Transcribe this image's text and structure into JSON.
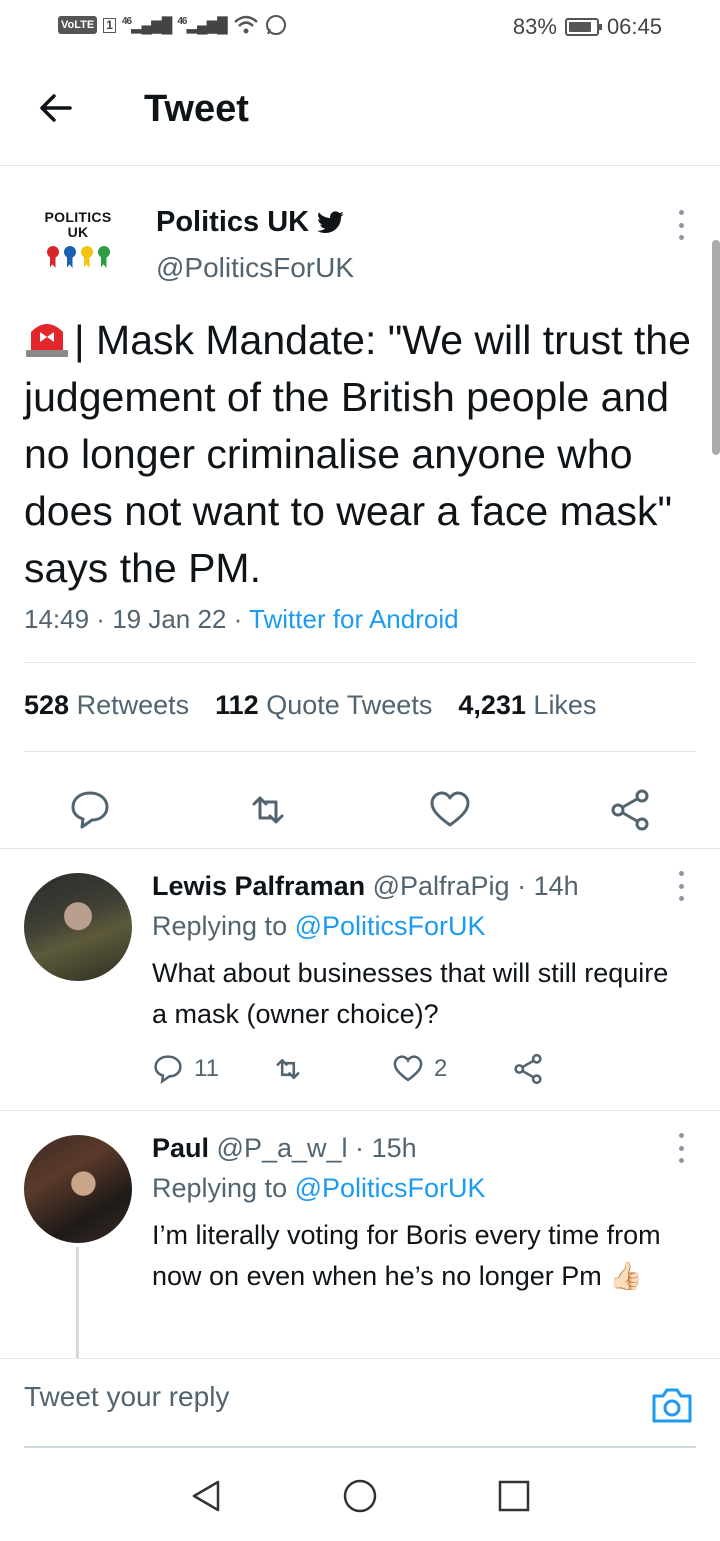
{
  "status_bar": {
    "volte": "VoLTE",
    "sim": "1",
    "signal_1": "46",
    "signal_2": "46",
    "battery": "83%",
    "battery_level": 0.83,
    "time": "06:45"
  },
  "header": {
    "title": "Tweet"
  },
  "tweet": {
    "logo_line1": "POLITICS",
    "logo_line2": "UK",
    "rosette_colors": [
      "#d62828",
      "#1d5fb3",
      "#f2c511",
      "#2e9e44"
    ],
    "author_name": "Politics UK",
    "handle": "@PoliticsForUK",
    "text": "| Mask Mandate: \"We will trust the judgement of the British people and no longer criminalise anyone who does not want to wear a face mask\" says the PM.",
    "time": "14:49",
    "date": "19 Jan 22",
    "source": "Twitter for Android",
    "retweets_count": "528",
    "retweets_label": "Retweets",
    "quotes_count": "112",
    "quotes_label": "Quote Tweets",
    "likes_count": "4,231",
    "likes_label": "Likes"
  },
  "replies": [
    {
      "name": "Lewis Palframan",
      "handle": "@PalfraPig",
      "time": "14h",
      "replying_prefix": "Replying to",
      "replying_to": "@PoliticsForUK",
      "text": "What about businesses that will still require a mask (owner choice)?",
      "reply_count": "11",
      "retweet_count": "",
      "like_count": "2"
    },
    {
      "name": "Paul",
      "handle": "@P_a_w_l",
      "time": "15h",
      "replying_prefix": "Replying to",
      "replying_to": "@PoliticsForUK",
      "text": "I’m literally voting for Boris every time from now on even when he’s no longer Pm 👍🏻"
    }
  ],
  "composer": {
    "placeholder": "Tweet your reply"
  },
  "colors": {
    "accent": "#1d9bf0",
    "muted": "#536471",
    "text": "#0f1419"
  }
}
